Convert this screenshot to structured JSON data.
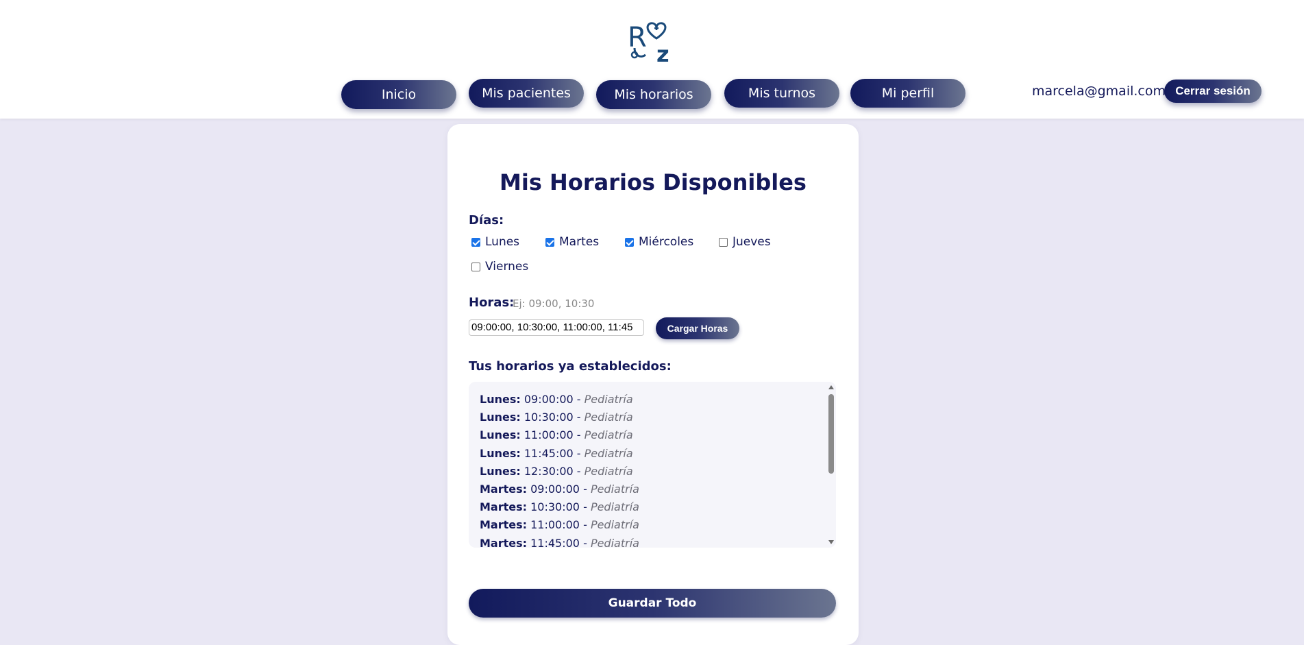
{
  "brand": {
    "logo_letters": "R Z",
    "logo_icon": "heart-cross-stethoscope-icon"
  },
  "nav": {
    "items": [
      {
        "label": "Inicio"
      },
      {
        "label": "Mis pacientes"
      },
      {
        "label": "Mis horarios"
      },
      {
        "label": "Mis turnos"
      },
      {
        "label": "Mi perfil"
      }
    ]
  },
  "user": {
    "email": "marcela@gmail.com",
    "logout_label": "Cerrar sesión"
  },
  "page": {
    "title": "Mis Horarios Disponibles",
    "days_label": "Días:",
    "days": [
      {
        "label": "Lunes",
        "checked": true
      },
      {
        "label": "Martes",
        "checked": true
      },
      {
        "label": "Miércoles",
        "checked": true
      },
      {
        "label": "Jueves",
        "checked": false
      },
      {
        "label": "Viernes",
        "checked": false
      }
    ],
    "hours_label": "Horas:",
    "hours_hint": "Ej: 09:00, 10:30",
    "hours_value": "09:00:00, 10:30:00, 11:00:00, 11:45",
    "load_button": "Cargar Horas",
    "established_label": "Tus horarios ya establecidos:",
    "schedules": [
      {
        "day": "Lunes:",
        "time": "09:00:00",
        "specialty": "Pediatría"
      },
      {
        "day": "Lunes:",
        "time": "10:30:00",
        "specialty": "Pediatría"
      },
      {
        "day": "Lunes:",
        "time": "11:00:00",
        "specialty": "Pediatría"
      },
      {
        "day": "Lunes:",
        "time": "11:45:00",
        "specialty": "Pediatría"
      },
      {
        "day": "Lunes:",
        "time": "12:30:00",
        "specialty": "Pediatría"
      },
      {
        "day": "Martes:",
        "time": "09:00:00",
        "specialty": "Pediatría"
      },
      {
        "day": "Martes:",
        "time": "10:30:00",
        "specialty": "Pediatría"
      },
      {
        "day": "Martes:",
        "time": "11:00:00",
        "specialty": "Pediatría"
      },
      {
        "day": "Martes:",
        "time": "11:45:00",
        "specialty": "Pediatría"
      }
    ],
    "save_button": "Guardar Todo"
  },
  "colors": {
    "accent": "#14195a",
    "background": "#e9e7f4",
    "checkbox": "#1a73e8"
  }
}
